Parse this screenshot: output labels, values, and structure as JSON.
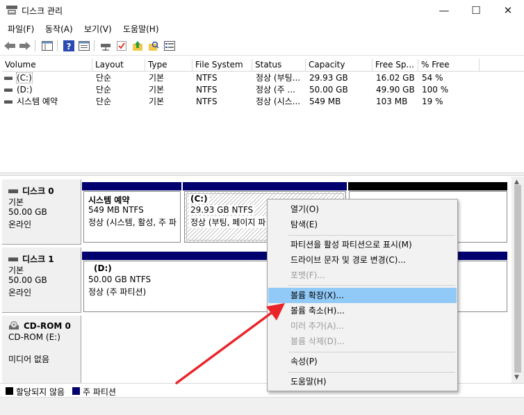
{
  "window": {
    "title": "디스크 관리",
    "minimize_icon": "minimize-icon",
    "maximize_icon": "maximize-icon",
    "close_icon": "close-icon"
  },
  "menu": [
    "파일(F)",
    "동작(A)",
    "보기(V)",
    "도움말(H)"
  ],
  "volumes": {
    "columns": [
      "Volume",
      "Layout",
      "Type",
      "File System",
      "Status",
      "Capacity",
      "Free Sp...",
      "% Free"
    ],
    "rows": [
      {
        "volume": "(C:)",
        "layout": "단순",
        "type": "기본",
        "fs": "NTFS",
        "status": "정상 (부팅...",
        "capacity": "29.93 GB",
        "free": "16.02 GB",
        "pct": "54 %"
      },
      {
        "volume": "(D:)",
        "layout": "단순",
        "type": "기본",
        "fs": "NTFS",
        "status": "정상 (주 ...",
        "capacity": "50.00 GB",
        "free": "49.90 GB",
        "pct": "100 %"
      },
      {
        "volume": "시스템 예약",
        "layout": "단순",
        "type": "기본",
        "fs": "NTFS",
        "status": "정상 (시스...",
        "capacity": "549 MB",
        "free": "103 MB",
        "pct": "19 %"
      }
    ]
  },
  "disks": [
    {
      "name": "디스크 0",
      "kind": "기본",
      "size": "50.00 GB",
      "state": "온라인",
      "partitions": [
        {
          "name": "시스템 예약",
          "size": "549 MB NTFS",
          "status": "정상 (시스템, 활성, 주 파"
        },
        {
          "name": "(C:)",
          "size": "29.93 GB NTFS",
          "status": "정상 (부팅, 페이지 파"
        }
      ]
    },
    {
      "name": "디스크 1",
      "kind": "기본",
      "size": "50.00 GB",
      "state": "온라인",
      "partitions": [
        {
          "name": "(D:)",
          "size": "50.00 GB NTFS",
          "status": "정상 (주 파티션)"
        }
      ]
    },
    {
      "name": "CD-ROM 0",
      "kind": "CD-ROM (E:)",
      "state": "미디어 없음"
    }
  ],
  "legend": {
    "unallocated": "할당되지 않음",
    "primary": "주 파티션",
    "unallocated_color": "#000000",
    "primary_color": "#00006e"
  },
  "context_menu": {
    "items": [
      {
        "label": "열기(O)",
        "enabled": true
      },
      {
        "label": "탐색(E)",
        "enabled": true
      },
      {
        "label": "파티션을 활성 파티션으로 표시(M)",
        "enabled": true
      },
      {
        "label": "드라이브 문자 및 경로 변경(C)...",
        "enabled": true
      },
      {
        "label": "포맷(F)...",
        "enabled": false
      },
      {
        "label": "볼륨 확장(X)...",
        "enabled": true,
        "highlighted": true
      },
      {
        "label": "볼륨 축소(H)...",
        "enabled": true
      },
      {
        "label": "미러 추가(A)...",
        "enabled": false
      },
      {
        "label": "볼륨 삭제(D)...",
        "enabled": false
      },
      {
        "label": "속성(P)",
        "enabled": true
      },
      {
        "label": "도움말(H)",
        "enabled": true
      }
    ],
    "highlight_color": "#91c9f7"
  },
  "annotation": {
    "arrow_color": "#e8262a"
  }
}
